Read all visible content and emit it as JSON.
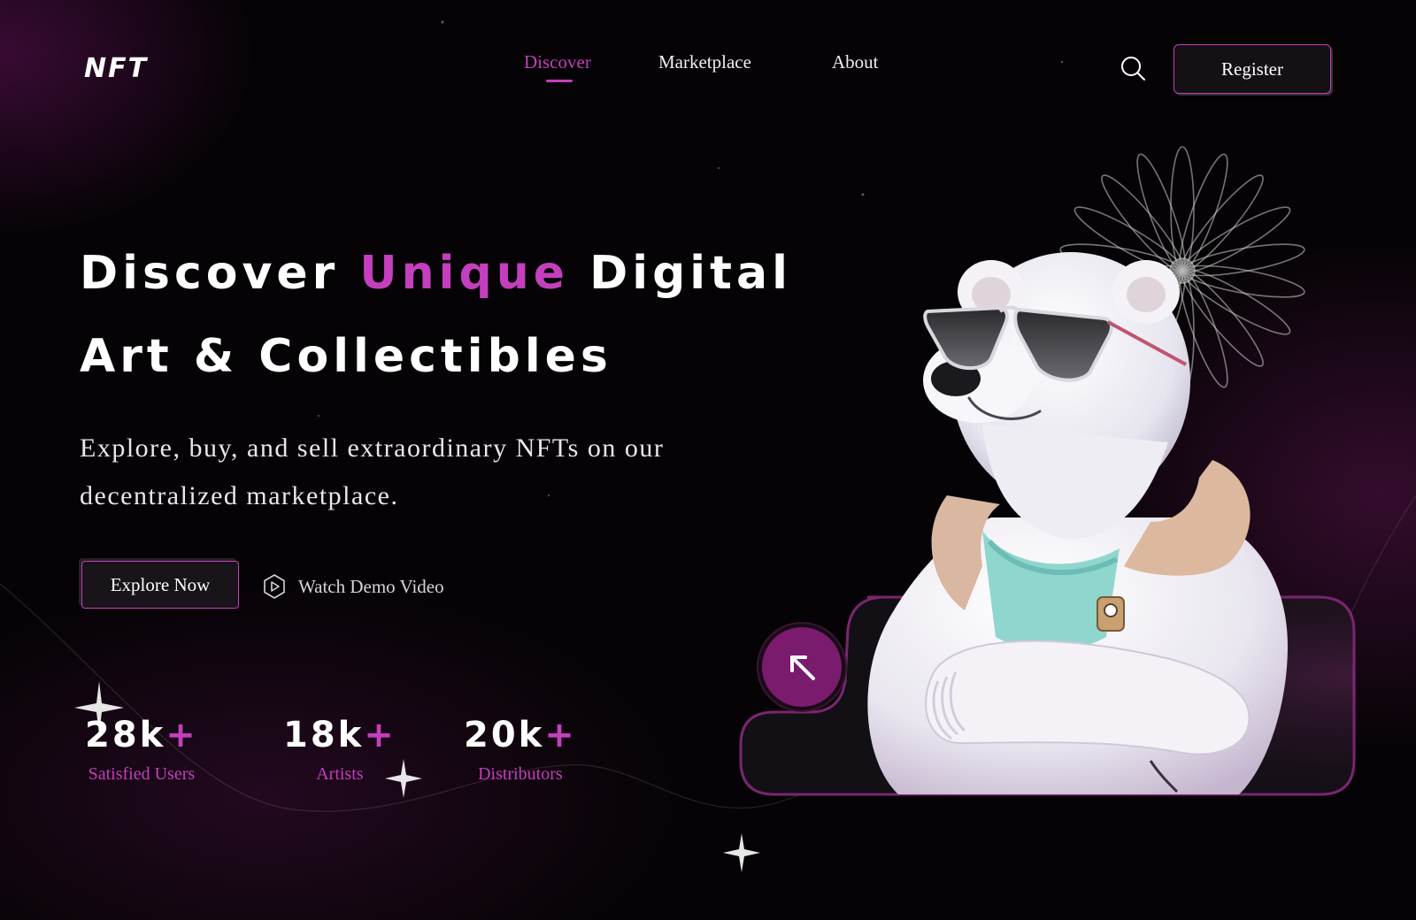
{
  "brand": {
    "logo_text": "NFT"
  },
  "nav": {
    "items": [
      {
        "label": "Discover",
        "active": true
      },
      {
        "label": "Marketplace",
        "active": false
      },
      {
        "label": "About",
        "active": false
      }
    ],
    "search_icon": "search-icon",
    "register_label": "Register"
  },
  "hero": {
    "title_part1": "Discover ",
    "title_accent": "Unique",
    "title_part2": " Digital",
    "title_line2": "Art & Collectibles",
    "subtitle_line1": "Explore, buy, and sell extraordinary NFTs on our",
    "subtitle_line2": "decentralized marketplace.",
    "primary_cta": "Explore Now",
    "secondary_cta": "Watch Demo Video",
    "secondary_icon": "play-hexagon-icon",
    "arrow_icon": "arrow-up-left-icon",
    "image_subject": "polar bear with sunglasses and white jacket"
  },
  "stats": [
    {
      "value": "28k",
      "suffix": "+",
      "label": "Satisfied Users"
    },
    {
      "value": "18k",
      "suffix": "+",
      "label": "Artists"
    },
    {
      "value": "20k",
      "suffix": "+",
      "label": "Distributors"
    }
  ],
  "colors": {
    "accent": "#c43fbe",
    "background": "#050305",
    "arrow_button": "#7a1b6e"
  }
}
